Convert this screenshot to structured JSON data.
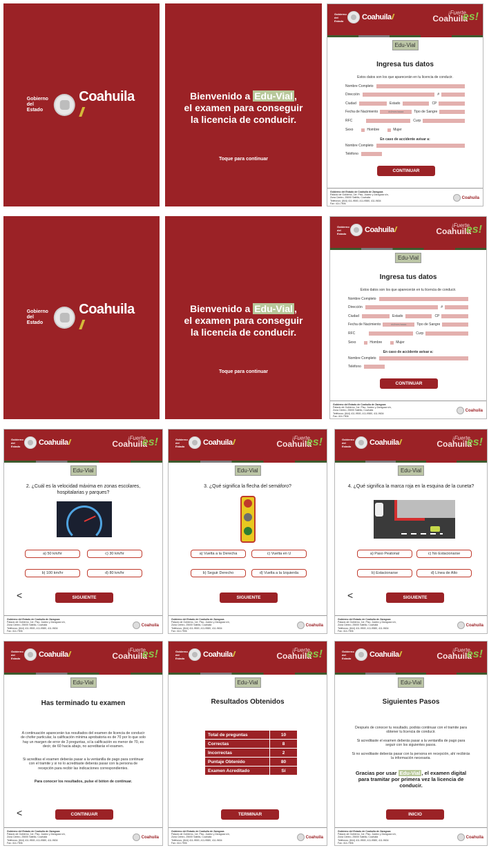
{
  "brand": {
    "gobierno": "Gobierno del Estado",
    "name": "Coahuila",
    "fuerte_top": "¡Fuerte,",
    "fuerte_bottom": "Coahuila",
    "es": "es!"
  },
  "edu_vial": "Edu-Vial",
  "welcome": {
    "line1_pre": "Bienvenido a",
    "line1_brand": "Edu-Vial",
    "line1_post": ",",
    "line2": "el examen para conseguir",
    "line3": "la licencia de conducir.",
    "tap": "Toque para continuar"
  },
  "form": {
    "title": "Ingresa tus datos",
    "subtitle": "Estos datos son los que aparecerán en tu licencia de conducir.",
    "nombre": "Nombre Completo",
    "direccion": "Dirección",
    "numero": "#",
    "ciudad": "Ciudad",
    "estado": "Estado",
    "cp": "CP",
    "fecha": "Fecha de Nacimiento",
    "fecha_placeholder": "dd/mm/aaaa",
    "sangre": "Tipo de Sangre",
    "rfc": "RFC",
    "curp": "Curp",
    "sexo": "Sexo",
    "hombre": "Hombre",
    "mujer": "Mujer",
    "accidente": "En caso de accidente avisar a:",
    "nombre2": "Nombre Completo",
    "telefono": "Teléfono",
    "continuar": "CONTINUAR"
  },
  "footer": {
    "line1": "Gobierno del Estado de Coahuila de Zaragoza",
    "line2": "Palacio de Gobierno, 1er. Piso, Juárez y Zaragoza s/n,",
    "line3": "Zona Centro, 25000 Saltillo, Coahuila",
    "line4": "Teléfonos: (844) 411-9500, 411-9580, 411-9634",
    "line5": "Fax: 414-7906",
    "logo": "Coahuila"
  },
  "q2": {
    "text": "2. ¿Cuál es la velocidad máxima en zonas escolares, hospitalarias y parques?",
    "a": "a) 50 km/hr",
    "b": "b) 100 km/hr",
    "c": "c) 30 km/hr",
    "d": "d) 80 km/hr"
  },
  "q3": {
    "text": "3. ¿Qué significa la flecha del semáforo?",
    "a": "a) Vuelta a la Derecha",
    "b": "b) Seguir Derecho",
    "c": "c) Vuelta en U",
    "d": "d) Vuelta a la Izquierda"
  },
  "q4": {
    "text": "4. ¿Qué significa la marca roja en la esquina de la cuneta?",
    "a": "a) Paso Peatonal",
    "b": "b) Estacionarse",
    "c": "c) No Estacionarse",
    "d": "d) Línea de Alto"
  },
  "siguiente": "SIGUIENTE",
  "back": "<",
  "done": {
    "title": "Has terminado tu examen",
    "p1": "A continuación aparecerán tus resultados del examen de licencia de conducir de chofer particular, la calificación mínima aprobatoria es de 70 por lo que solo hay un margen de error de 3 preguntas, si la calificación es menor de 70, es decir, de 60 hacia abajo, no acreditarás el examen.",
    "p2": "Si acreditas el examen deberás pasar a la ventanilla de pago para continuar con el tramite y si no lo acreditaste deberás pasar con la persona de recepción para recibir las indicaciones correspondientes.",
    "p3": "Para conocer los resultados, pulse el bóton de continuar.",
    "btn": "CONTINUAR"
  },
  "results": {
    "title": "Resultados Obtenidos",
    "rows": [
      {
        "label": "Total de preguntas",
        "value": "10"
      },
      {
        "label": "Correctas",
        "value": "8"
      },
      {
        "label": "Incorrectas",
        "value": "2"
      },
      {
        "label": "Puntaje Obtenido",
        "value": "80"
      },
      {
        "label": "Examen Acreditado",
        "value": "Sí"
      }
    ],
    "btn": "TERMINAR"
  },
  "next": {
    "title": "Siguientes Pasos",
    "p1": "Después de conocer tu resultado, podrás continuar con el tramite para obtener tu licencia de conducir.",
    "p2": "Si acreditaste el examen deberás pasar a la ventanilla de pago para seguir con los siguientes pasos.",
    "p3": "Si no acreditaste deberás pasar con la persona en recepción, ahí recibirás la información necesaria.",
    "thanks_pre": "Gracias por usar",
    "thanks_brand": "Edu-Vial",
    "thanks_post": ", el examen digital para tramitar por primera vez la licencia de conducir.",
    "btn": "INICIO"
  },
  "colors": {
    "primary": "#9b2226",
    "accent": "#b8c89a",
    "field": "#e3b0ae"
  }
}
